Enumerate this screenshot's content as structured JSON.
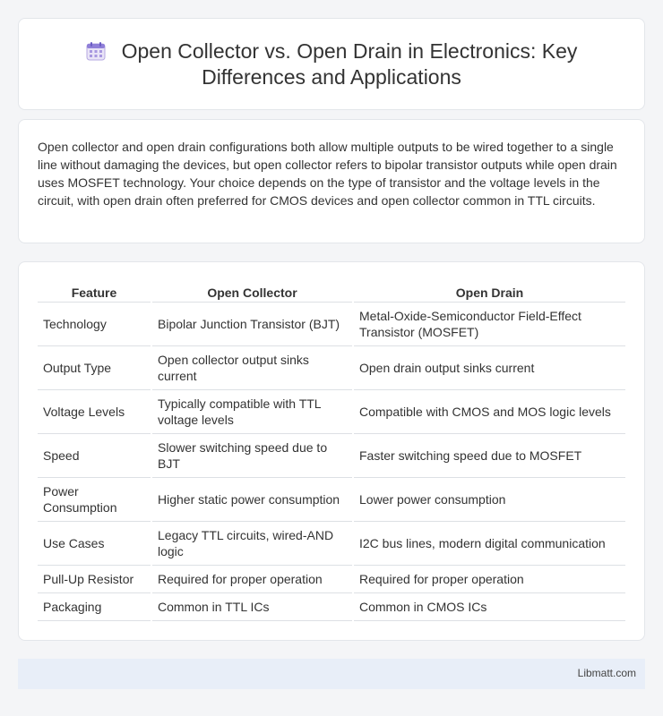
{
  "header": {
    "icon": "calendar-icon",
    "title": "Open Collector vs. Open Drain in Electronics: Key Differences and Applications"
  },
  "intro": {
    "text": "Open collector and open drain configurations both allow multiple outputs to be wired together to a single line without damaging the devices, but open collector refers to bipolar transistor outputs while open drain uses MOSFET technology. Your choice depends on the type of transistor and the voltage levels in the circuit, with open drain often preferred for CMOS devices and open collector common in TTL circuits."
  },
  "table": {
    "headers": [
      "Feature",
      "Open Collector",
      "Open Drain"
    ],
    "rows": [
      [
        "Technology",
        "Bipolar Junction Transistor (BJT)",
        "Metal-Oxide-Semiconductor Field-Effect Transistor (MOSFET)"
      ],
      [
        "Output Type",
        "Open collector output sinks current",
        "Open drain output sinks current"
      ],
      [
        "Voltage Levels",
        "Typically compatible with TTL voltage levels",
        "Compatible with CMOS and MOS logic levels"
      ],
      [
        "Speed",
        "Slower switching speed due to BJT",
        "Faster switching speed due to MOSFET"
      ],
      [
        "Power Consumption",
        "Higher static power consumption",
        "Lower power consumption"
      ],
      [
        "Use Cases",
        "Legacy TTL circuits, wired-AND logic",
        "I2C bus lines, modern digital communication"
      ],
      [
        "Pull-Up Resistor",
        "Required for proper operation",
        "Required for proper operation"
      ],
      [
        "Packaging",
        "Common in TTL ICs",
        "Common in CMOS ICs"
      ]
    ]
  },
  "footer": {
    "brand": "Libmatt.com"
  },
  "colors": {
    "background": "#f4f5f7",
    "card": "#ffffff",
    "footer": "#e8eef8",
    "icon_accent": "#7b8fd6"
  }
}
